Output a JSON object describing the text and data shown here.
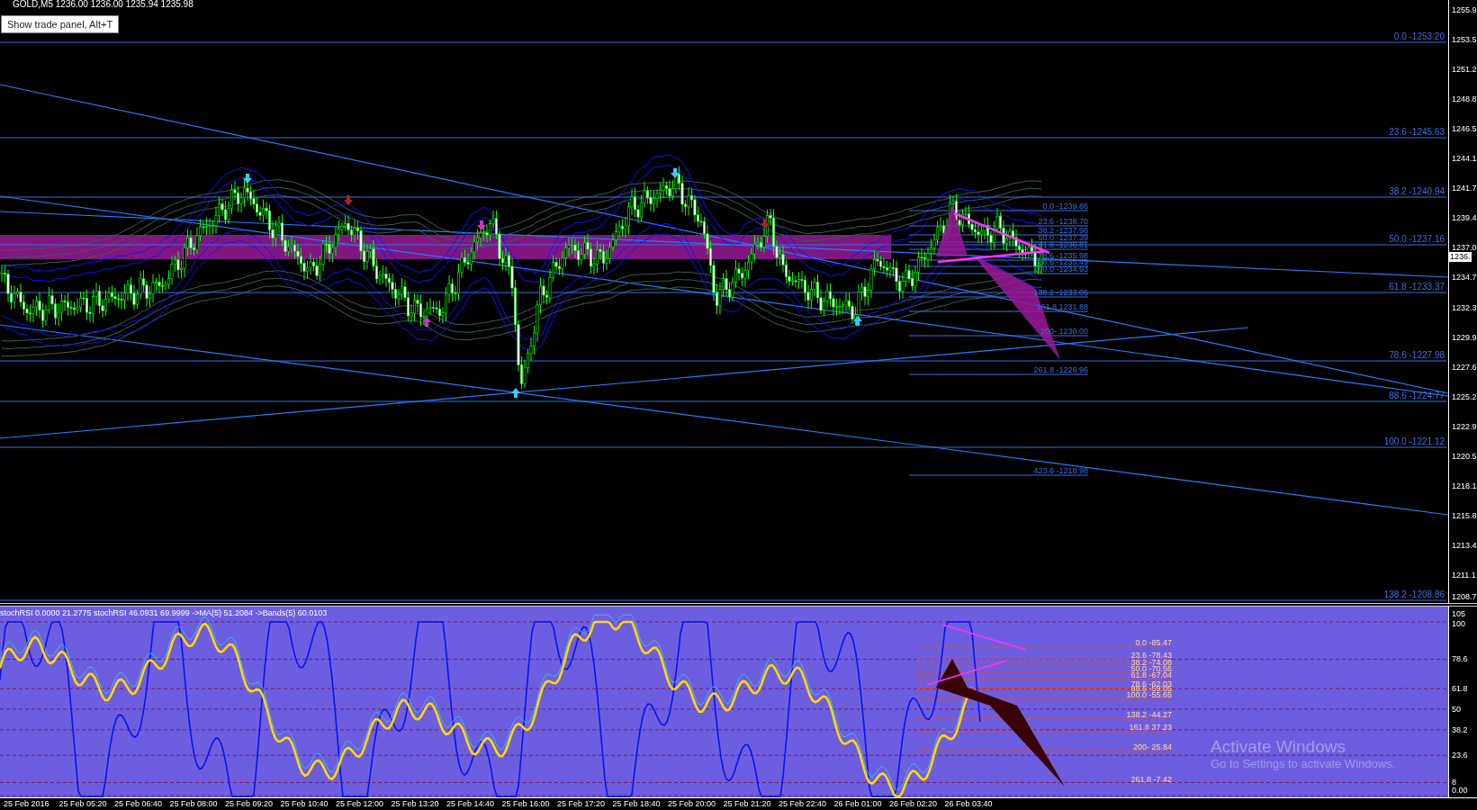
{
  "chart_header": {
    "title": "GOLD,M5 1236.00 1236.00 1235.94 1235.98",
    "trade_panel_button": "Show trade panel, Alt+T"
  },
  "price_axis": {
    "labels": [
      "1255.9",
      "1253.5",
      "1251.2",
      "1248.8",
      "1246.5",
      "1244.1",
      "1241.7",
      "1239.4",
      "1237.0",
      "1234.7",
      "1232.3",
      "1229.9",
      "1227.6",
      "1225.2",
      "1222.9",
      "1220.5",
      "1218.1",
      "1215.8",
      "1213.4",
      "1211.1",
      "1208.7"
    ],
    "current_price": "1236."
  },
  "fibonacci_main": [
    "0.0 -1253.20",
    "23.6 -1245.63",
    "38.2 -1240.94",
    "50.0 -1237.16",
    "61.8 -1233.37",
    "78.6 -1227.98",
    "88.6 -1224.77",
    "100.0 -1221.12",
    "138.2 -1208.86"
  ],
  "fibonacci_local": [
    "0.0 -1239.86",
    "23.6 -1238.70",
    "38.2 -1237.98",
    "50.0 -1237.39",
    "61.8 -1236.81",
    "78.6 -1235.98",
    "88.6 -1235.49",
    "100.0 -1234.93",
    "138.2 -1233.05",
    "161.8 1231.88",
    "200- 1230.00",
    "261.8 -1226.96",
    "423.6 -1218.98"
  ],
  "indicator": {
    "header": "stochRSI 0.0000 21.2775  stochRSI 46.0931 69.9999 ->MA(5) 51.2084  ->Bands(5) 60.0103",
    "axis_labels": [
      "105",
      "100",
      "78.6",
      "61.8",
      "50",
      "38.2",
      "23.6",
      "8",
      "0.00"
    ],
    "fibonacci": [
      "0.0 -85.47",
      "23.6 -78.43",
      "38.2 -74.08",
      "50.0 -70.56",
      "61.8 -67.04",
      "78.6 -62.03",
      "88.6 -59.05",
      "100.0 -55.65",
      "138.2 -44.27",
      "161.8 37.23",
      "200- 25.84",
      "261.8 -7.42"
    ]
  },
  "time_axis": [
    "25 Feb 2016",
    "25 Feb 05:20",
    "25 Feb 06:40",
    "25 Feb 08:00",
    "25 Feb 09:20",
    "25 Feb 10:40",
    "25 Feb 12:00",
    "25 Feb 13:20",
    "25 Feb 14:40",
    "25 Feb 16:00",
    "25 Feb 17:20",
    "25 Feb 18:40",
    "25 Feb 20:00",
    "25 Feb 21:20",
    "25 Feb 22:40",
    "26 Feb 01:00",
    "26 Feb 02:20",
    "26 Feb 03:40"
  ],
  "os_notice": {
    "title": "Activate Windows",
    "subtitle": "Go to Settings to activate Windows."
  }
}
